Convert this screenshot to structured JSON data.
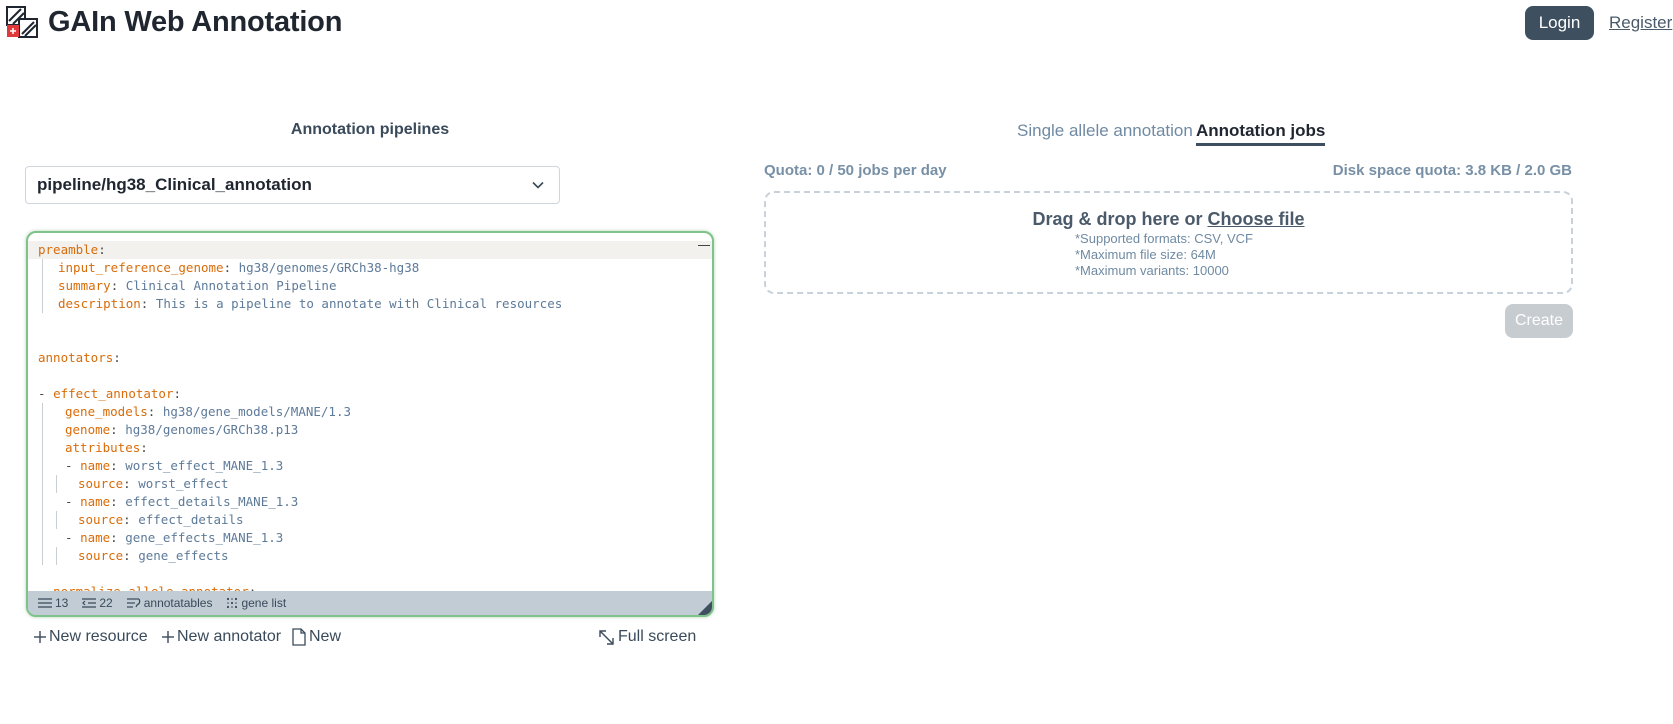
{
  "header": {
    "app_title": "GAIn Web Annotation",
    "login_label": "Login",
    "register_label": "Register"
  },
  "left": {
    "heading": "Annotation pipelines",
    "pipeline_selected": "pipeline/hg38_Clinical_annotation",
    "editor": {
      "lines": [
        [
          {
            "c": "k",
            "t": "preamble"
          },
          {
            "c": "p",
            "t": ":"
          }
        ],
        [
          {
            "c": "k",
            "t": "input_reference_genome"
          },
          {
            "c": "p",
            "t": ": "
          },
          {
            "c": "v",
            "t": "hg38/genomes/GRCh38-hg38"
          }
        ],
        [
          {
            "c": "k",
            "t": "summary"
          },
          {
            "c": "p",
            "t": ": "
          },
          {
            "c": "v",
            "t": "Clinical Annotation Pipeline"
          }
        ],
        [
          {
            "c": "k",
            "t": "description"
          },
          {
            "c": "p",
            "t": ": "
          },
          {
            "c": "v",
            "t": "This is a pipeline to annotate with Clinical resources"
          }
        ],
        [],
        [],
        [
          {
            "c": "k",
            "t": "annotators"
          },
          {
            "c": "p",
            "t": ":"
          }
        ],
        [],
        [
          {
            "c": "p",
            "t": "- "
          },
          {
            "c": "k",
            "t": "effect_annotator"
          },
          {
            "c": "p",
            "t": ":"
          }
        ],
        [
          {
            "c": "k",
            "t": "gene_models"
          },
          {
            "c": "p",
            "t": ": "
          },
          {
            "c": "v",
            "t": "hg38/gene_models/MANE/1.3"
          }
        ],
        [
          {
            "c": "k",
            "t": "genome"
          },
          {
            "c": "p",
            "t": ": "
          },
          {
            "c": "v",
            "t": "hg38/genomes/GRCh38.p13"
          }
        ],
        [
          {
            "c": "k",
            "t": "attributes"
          },
          {
            "c": "p",
            "t": ":"
          }
        ],
        [
          {
            "c": "p",
            "t": "- "
          },
          {
            "c": "k",
            "t": "name"
          },
          {
            "c": "p",
            "t": ": "
          },
          {
            "c": "v",
            "t": "worst_effect_MANE_1.3"
          }
        ],
        [
          {
            "c": "k",
            "t": "source"
          },
          {
            "c": "p",
            "t": ": "
          },
          {
            "c": "v",
            "t": "worst_effect"
          }
        ],
        [
          {
            "c": "p",
            "t": "- "
          },
          {
            "c": "k",
            "t": "name"
          },
          {
            "c": "p",
            "t": ": "
          },
          {
            "c": "v",
            "t": "effect_details_MANE_1.3"
          }
        ],
        [
          {
            "c": "k",
            "t": "source"
          },
          {
            "c": "p",
            "t": ": "
          },
          {
            "c": "v",
            "t": "effect_details"
          }
        ],
        [
          {
            "c": "p",
            "t": "- "
          },
          {
            "c": "k",
            "t": "name"
          },
          {
            "c": "p",
            "t": ": "
          },
          {
            "c": "v",
            "t": "gene_effects_MANE_1.3"
          }
        ],
        [
          {
            "c": "k",
            "t": "source"
          },
          {
            "c": "p",
            "t": ": "
          },
          {
            "c": "v",
            "t": "gene_effects"
          }
        ],
        [],
        [
          {
            "c": "p",
            "t": "- "
          },
          {
            "c": "k",
            "t": "normalize_allele_annotator"
          },
          {
            "c": "p",
            "t": ":"
          }
        ]
      ],
      "status": {
        "lines_count": "13",
        "indent_count": "22",
        "annotatables_label": "annotatables",
        "gene_list_label": "gene list"
      }
    },
    "toolbar": {
      "new_resource": "New resource",
      "new_annotator": "New annotator",
      "new": "New",
      "full_screen": "Full screen"
    }
  },
  "right": {
    "tabs": {
      "single": "Single allele annotation",
      "jobs": "Annotation jobs"
    },
    "quota": "Quota: 0 / 50 jobs per day",
    "disk_quota": "Disk space quota: 3.8 KB / 2.0 GB",
    "dropzone": {
      "prefix": "Drag & drop here or ",
      "choose": "Choose file",
      "formats": "*Supported formats: CSV, VCF",
      "max_size": "*Maximum file size: 64M",
      "max_variants": "*Maximum variants: 10000"
    },
    "create_label": "Create"
  },
  "colors": {
    "accent": "#3e4f5f",
    "editor_border": "#7fc28a",
    "yaml_key": "#d86c0a",
    "yaml_value": "#5d7a99",
    "logo_red": "#e0393b"
  }
}
